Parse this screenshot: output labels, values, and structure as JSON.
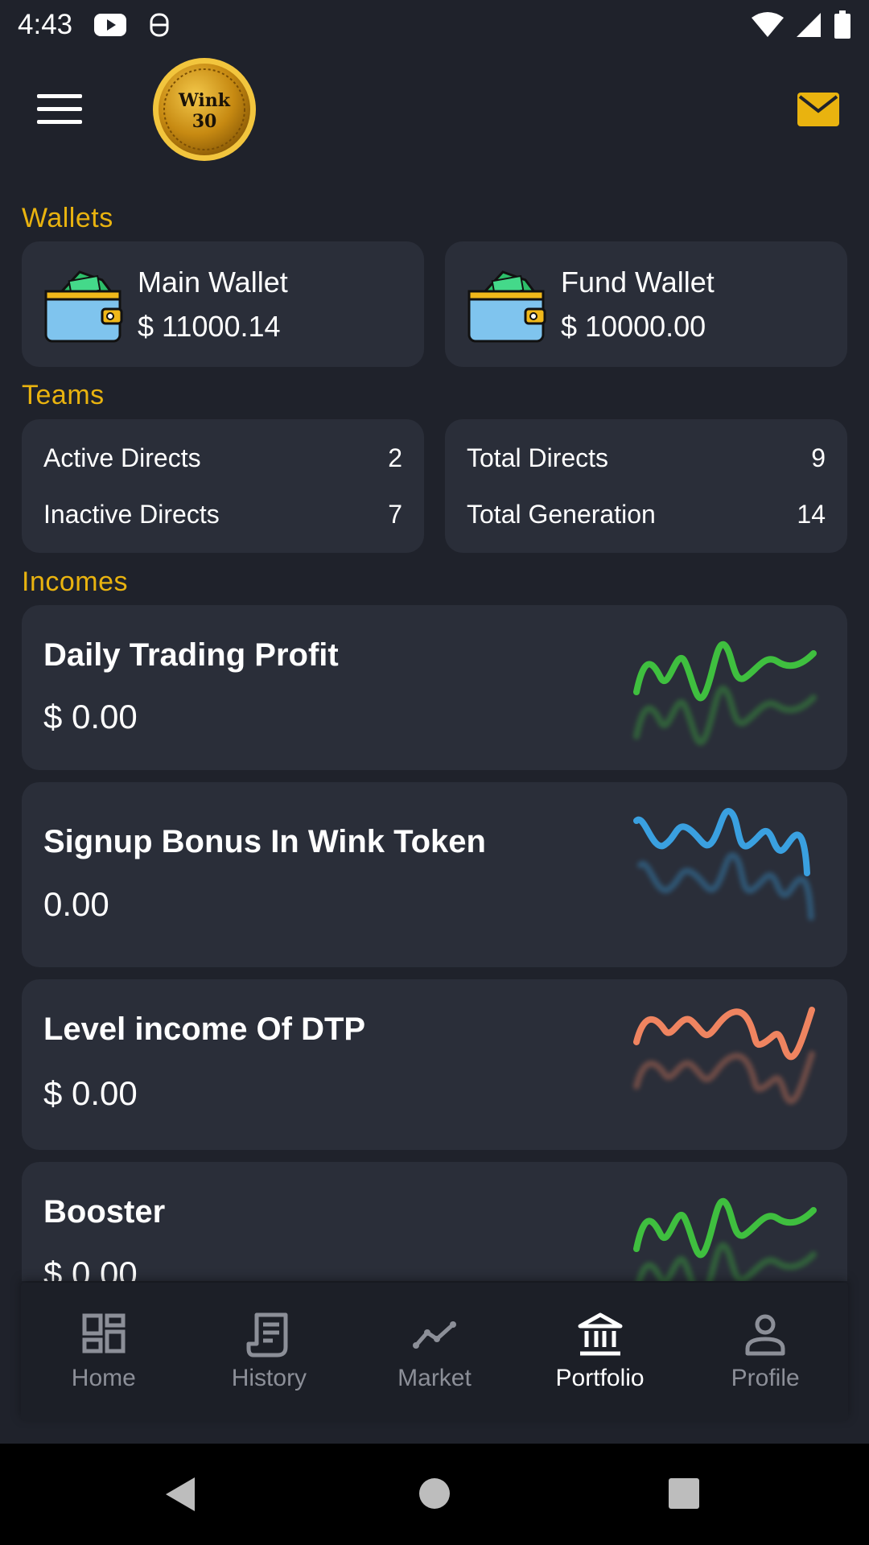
{
  "status": {
    "time": "4:43"
  },
  "sections": {
    "wallets": "Wallets",
    "teams": "Teams",
    "incomes": "Incomes"
  },
  "wallets": [
    {
      "name": "Main Wallet",
      "amount": "$ 11000.14"
    },
    {
      "name": "Fund Wallet",
      "amount": "$ 10000.00"
    }
  ],
  "teams": {
    "left": [
      {
        "label": "Active Directs",
        "value": "2"
      },
      {
        "label": "Inactive Directs",
        "value": "7"
      }
    ],
    "right": [
      {
        "label": "Total Directs",
        "value": "9"
      },
      {
        "label": "Total Generation",
        "value": "14"
      }
    ]
  },
  "incomes": [
    {
      "title": "Daily Trading Profit",
      "value": "$ 0.00",
      "color": "#3fbf3f"
    },
    {
      "title": "Signup Bonus In Wink Token",
      "value": "0.00",
      "color": "#3aa0e0"
    },
    {
      "title": "Level income Of DTP",
      "value": "$ 0.00",
      "color": "#ef8460"
    },
    {
      "title": "Booster",
      "value": "$ 0.00",
      "color": "#3fbf3f"
    }
  ],
  "nav": [
    {
      "label": "Home",
      "icon": "dashboard-icon"
    },
    {
      "label": "History",
      "icon": "receipt-icon"
    },
    {
      "label": "Market",
      "icon": "trend-line-icon"
    },
    {
      "label": "Portfolio",
      "icon": "bank-icon",
      "active": true
    },
    {
      "label": "Profile",
      "icon": "person-icon"
    }
  ],
  "colors": {
    "accent": "#e9b30f",
    "card": "#2a2e39",
    "background": "#1f222b"
  }
}
